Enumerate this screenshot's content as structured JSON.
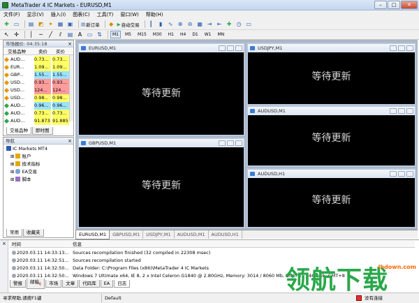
{
  "window": {
    "title": "MetaTrader 4 IC Markets - EURUSD,M1"
  },
  "menu": [
    "文件(F)",
    "显示(V)",
    "插入(I)",
    "图表(C)",
    "工具(T)",
    "窗口(W)",
    "帮助(H)"
  ],
  "toolbar": {
    "new_order": "新订单",
    "auto_trading": "自动交易"
  },
  "timeframes": [
    "M1",
    "M5",
    "M15",
    "M30",
    "H1",
    "H4",
    "D1",
    "W1",
    "MN"
  ],
  "market_watch": {
    "title": "市场报价: 04:35:18",
    "col_symbol": "交易品种",
    "col_bid": "卖价",
    "col_ask": "买价",
    "rows": [
      {
        "symbol": "AUD...",
        "bid": "0.73...",
        "ask": "0.73...",
        "color": "#ffff66",
        "icon": "#e69500"
      },
      {
        "symbol": "EUR...",
        "bid": "1.09...",
        "ask": "1.09...",
        "color": "#ffff66",
        "icon": "#e69500"
      },
      {
        "symbol": "GBP...",
        "bid": "1.55...",
        "ask": "1.55...",
        "color": "#9be3ff",
        "icon": "#e69500"
      },
      {
        "symbol": "USD...",
        "bid": "0.93...",
        "ask": "0.93...",
        "color": "#ff9c9c",
        "icon": "#e69500"
      },
      {
        "symbol": "USD...",
        "bid": "124...",
        "ask": "124...",
        "color": "#ff9c9c",
        "icon": "#e69500"
      },
      {
        "symbol": "USD...",
        "bid": "0.98...",
        "ask": "0.98...",
        "color": "#ffff66",
        "icon": "#e69500"
      },
      {
        "symbol": "AUD...",
        "bid": "0.96...",
        "ask": "0.96...",
        "color": "#9be3ff",
        "icon": "#2aa84a"
      },
      {
        "symbol": "AUD...",
        "bid": "0.73...",
        "ask": "0.73...",
        "color": "#ffff66",
        "icon": "#2aa84a"
      },
      {
        "symbol": "AUD...",
        "bid": "91.873",
        "ask": "91.885",
        "color": "#ffff66",
        "icon": "#2aa84a"
      }
    ],
    "tabs": [
      "交易品种",
      "即时图"
    ]
  },
  "navigator": {
    "title": "导航",
    "root": "IC Markets MT4",
    "items": [
      "账户",
      "技术指标",
      "EA交易",
      "脚本"
    ],
    "tabs": [
      "常用",
      "收藏夹"
    ]
  },
  "charts": {
    "placeholder": "等待更新",
    "windows": [
      "EURUSD,M1",
      "USDJPY,M1",
      "GBPUSD,M1",
      "AUDUSD,M1",
      "AUDUSD,H1"
    ]
  },
  "chart_tabs": [
    "EURUSD,M1",
    "GBPUSD,M1",
    "USDJPY,M1",
    "AUDUSD,M1",
    "AUDUSD,H1"
  ],
  "terminal": {
    "col_time": "时间",
    "col_info": "信息",
    "logs": [
      {
        "time": "2020.03.11 14:33:13...",
        "info": "Sources recompilation finished (32 compiled in 22308 msec)"
      },
      {
        "time": "2020.03.11 14:32:51...",
        "info": "Sources recompilation started"
      },
      {
        "time": "2020.03.11 14:32:50...",
        "info": "Data Folder: C:\\Program Files (x86)\\MetaTrader 4 IC Markets"
      },
      {
        "time": "2020.03.11 14:32:50...",
        "info": "Windows 7 Ultimate x64, IE 8, 2 x Intel Celeron  G1840 @ 2.80GHz, Memory: 3014 / 8060 Mb, Disk: 41 / 464 Gb, GMT+8"
      }
    ],
    "tabs": [
      "警报",
      "邮箱",
      "市场",
      "文章",
      "代码库",
      "EA",
      "日志"
    ],
    "mail_count": "6"
  },
  "status": {
    "help": "寻求帮助,请按F1键",
    "profile": "Default",
    "connection": "没有连接"
  },
  "watermark": {
    "text": "领航下载",
    "url": "lhdown.com"
  }
}
